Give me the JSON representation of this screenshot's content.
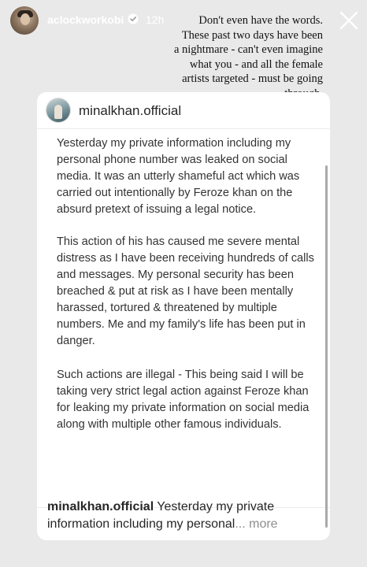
{
  "story": {
    "username": "aclockworkobi",
    "time": "12h",
    "caption": "Don't even have the words.\nThese past two days have been\na nightmare - can't even imagine\nwhat you - and all the female\nartists targeted - must be going\nthrough."
  },
  "post": {
    "author": "minalkhan.official",
    "paragraphs": [
      "Yesterday my private information including my personal phone number was leaked on social media. It was an utterly shameful act which was carried out intentionally by Feroze khan on the absurd pretext of issuing a legal notice.",
      "This action of his has caused me severe mental distress as I have been receiving hundreds of calls and messages. My personal security has been breached & put at risk as I have been mentally harassed, tortured & threatened by multiple numbers. Me and my family's life has been put in danger.",
      "Such actions are illegal - This being said I will be taking very strict legal action against Feroze khan for leaking my private information on social media along with multiple other famous individuals."
    ],
    "caption_author": "minalkhan.official",
    "caption_text": " Yesterday my private information including my personal",
    "caption_more": "... more"
  },
  "colors": {
    "background": "#e9e9e9",
    "card": "#ffffff",
    "verified": "#3897f0"
  },
  "icons": {
    "verified": "verified-badge-icon",
    "more": "more-options-icon",
    "close": "close-icon"
  }
}
